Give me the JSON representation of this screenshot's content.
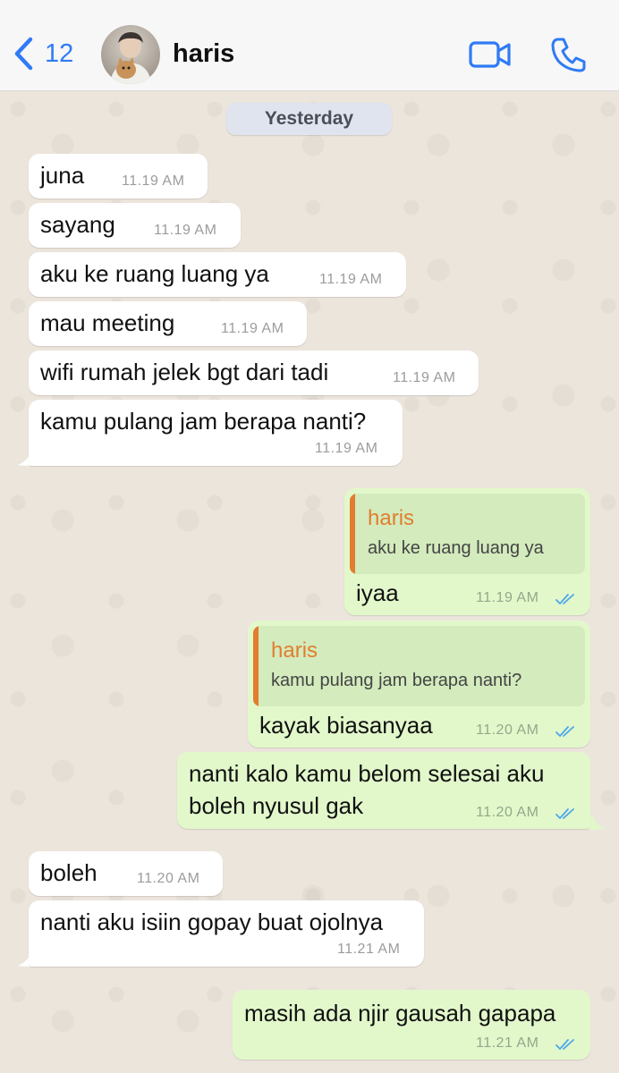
{
  "header": {
    "back_count": "12",
    "contact_name": "haris",
    "accent_color": "#2f7bf5",
    "icons": [
      "chevron-left-icon",
      "video-camera-icon",
      "phone-icon"
    ]
  },
  "chat": {
    "date_label": "Yesterday",
    "messages": [
      {
        "dir": "in",
        "text": "juna",
        "time": "11.19 AM"
      },
      {
        "dir": "in",
        "text": "sayang",
        "time": "11.19 AM"
      },
      {
        "dir": "in",
        "text": "aku ke ruang luang ya",
        "time": "11.19 AM"
      },
      {
        "dir": "in",
        "text": "mau meeting",
        "time": "11.19 AM"
      },
      {
        "dir": "in",
        "text": "wifi rumah jelek bgt dari tadi",
        "time": "11.19 AM"
      },
      {
        "dir": "in",
        "text": "kamu pulang jam berapa nanti?",
        "time": "11.19 AM"
      },
      {
        "dir": "out",
        "quote_name": "haris",
        "quote_text": "aku ke ruang luang ya",
        "text": "iyaa",
        "time": "11.19 AM",
        "status": "read"
      },
      {
        "dir": "out",
        "quote_name": "haris",
        "quote_text": "kamu pulang jam berapa nanti?",
        "text": "kayak biasanyaa",
        "time": "11.20 AM",
        "status": "read"
      },
      {
        "dir": "out",
        "text_line1": "nanti kalo kamu belom selesai aku",
        "text_line2": "boleh nyusul gak",
        "time": "11.20 AM",
        "status": "read"
      },
      {
        "dir": "in",
        "text": "boleh",
        "time": "11.20 AM"
      },
      {
        "dir": "in",
        "text": "nanti aku isiin gopay buat ojolnya",
        "time": "11.21 AM"
      },
      {
        "dir": "out",
        "text": "masih ada njir gausah gapapa",
        "time": "11.21 AM",
        "status": "read"
      }
    ]
  },
  "colors": {
    "incoming_bubble": "#ffffff",
    "outgoing_bubble": "#e2f8cb",
    "quote_accent": "#e27d2f",
    "read_ticks": "#4fa6ea",
    "chat_background": "#ece5dc"
  }
}
